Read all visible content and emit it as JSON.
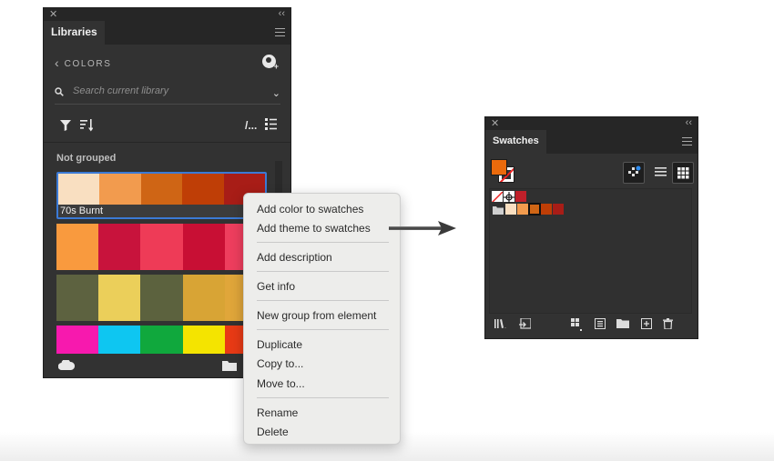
{
  "libraries_panel": {
    "tab_title": "Libraries",
    "nav_label": "COLORS",
    "search_placeholder": "Search current library",
    "group_label": "Not grouped",
    "themes": [
      {
        "name": "70s Burnt",
        "colors": [
          "#f9dfc1",
          "#f29b4e",
          "#cf6515",
          "#bf3e06",
          "#a81d17"
        ]
      },
      {
        "name": "",
        "colors": [
          "#f99a3e",
          "#c8133c",
          "#ee3b57",
          "#c80f34",
          "#ee3e5e"
        ]
      },
      {
        "name": "",
        "colors": [
          "#5d6240",
          "#ebcf5a",
          "#5c623e",
          "#d8a435",
          "#e0a63a"
        ]
      },
      {
        "name": "",
        "colors": [
          "#f719ae",
          "#0ec6f1",
          "#10a83d",
          "#f4e400",
          "#e83a15"
        ]
      }
    ]
  },
  "context_menu": {
    "items": [
      "Add color to swatches",
      "Add theme to swatches",
      "Add description",
      "Get info",
      "New group from element",
      "Duplicate",
      "Copy to...",
      "Move to...",
      "Rename",
      "Delete"
    ]
  },
  "swatches_panel": {
    "tab_title": "Swatches",
    "fill_color": "#ea6a0c",
    "row1_colors": [
      "none",
      "registration",
      "#c0202a"
    ],
    "group_colors": [
      "#f9dfc1",
      "#f29b4e",
      "#cf6515",
      "#bf3e06",
      "#a81d17"
    ]
  },
  "colors": {
    "panel_bg": "#323232",
    "selection_blue": "#3b7ad6",
    "menu_bg": "#ededeb"
  }
}
